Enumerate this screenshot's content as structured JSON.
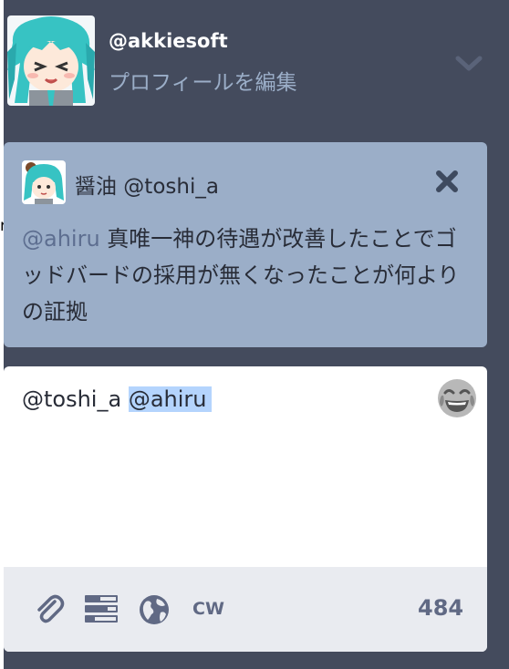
{
  "account": {
    "username": "@akkiesoft",
    "edit_profile": "プロフィールを編集"
  },
  "left_edge": {
    "stray_char": "r"
  },
  "reply": {
    "author": "醤油 @toshi_a",
    "mention": "@ahiru",
    "text": " 真唯一神の待遇が改善したことでゴッドバードの採用が無くなったことが何よりの証拠"
  },
  "compose": {
    "text_prefix": "@toshi_a ",
    "text_selected": "@ahiru",
    "cw_label": "CW",
    "char_count": "484"
  },
  "icons": {
    "chevron": "chevron-down-icon",
    "close": "close-icon",
    "emoji": "laughing-crying-emoji-icon",
    "attach": "paperclip-icon",
    "poll": "poll-icon",
    "visibility": "globe-icon"
  },
  "colors": {
    "background": "#444b5d",
    "reply_card": "#9baec8",
    "mention": "#5d6e90",
    "selection": "#b4d4fd",
    "footer_text": "#606984"
  }
}
